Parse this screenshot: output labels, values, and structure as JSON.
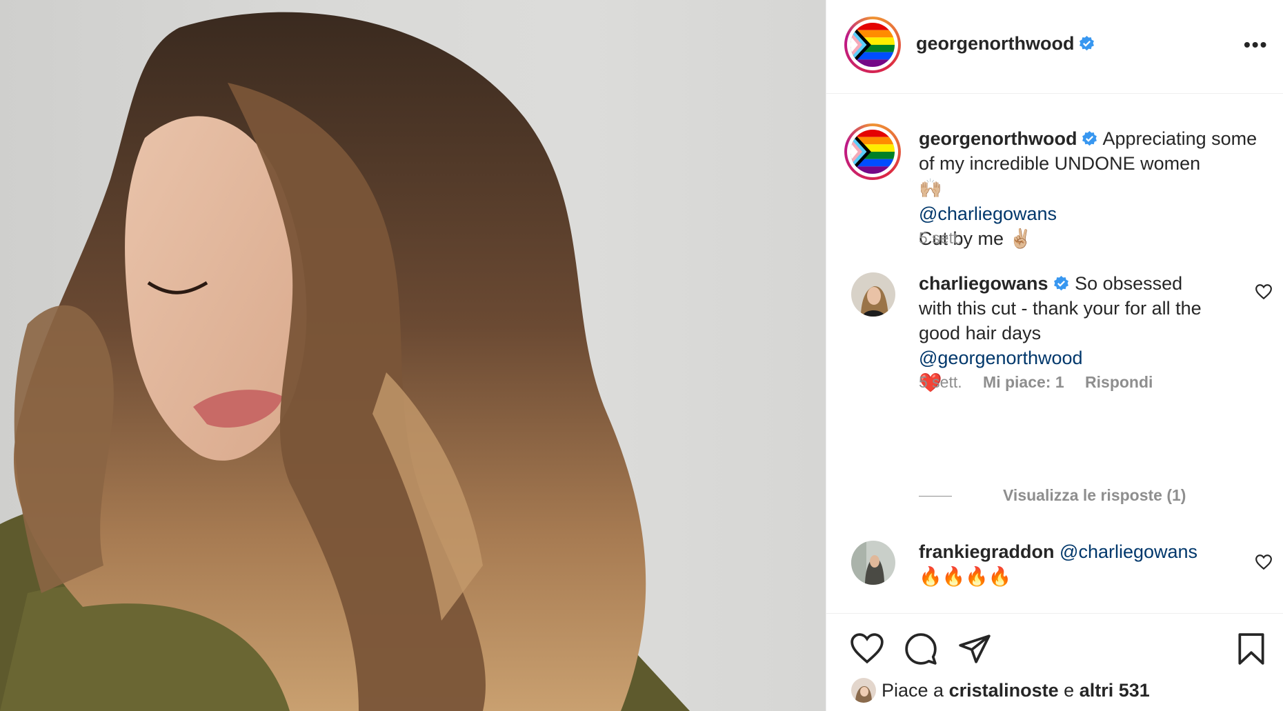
{
  "photo": {
    "alt_subject": "woman with long balayage hair, eyes closed"
  },
  "header": {
    "username": "georgenorthwood",
    "more_label": "•••"
  },
  "caption": {
    "username": "georgenorthwood",
    "text": "Appreciating some of my incredible UNDONE women",
    "emoji_1": "🙌🏼",
    "mention": "@charliegowans",
    "line2": "Cut by me",
    "emoji_2": "✌🏼",
    "time": "5 sett."
  },
  "comments": [
    {
      "username": "charliegowans",
      "text": "So obsessed with this cut - thank your for all the good hair days",
      "mention": "@georgenorthwood",
      "emoji": "❤️",
      "time": "5 sett.",
      "likes": "Mi piace: 1",
      "reply": "Rispondi",
      "view_replies": "Visualizza le risposte (1)"
    },
    {
      "username": "frankiegraddon",
      "mention": "@charliegowans",
      "emoji": "🔥🔥🔥🔥"
    }
  ],
  "likes_line": {
    "prefix": "Piace a",
    "user": "cristalinoste",
    "middle": "e",
    "others": "altri 531"
  },
  "colors": {
    "verified": "#3897f0",
    "link": "#00376b",
    "muted": "#8e8e8e"
  }
}
